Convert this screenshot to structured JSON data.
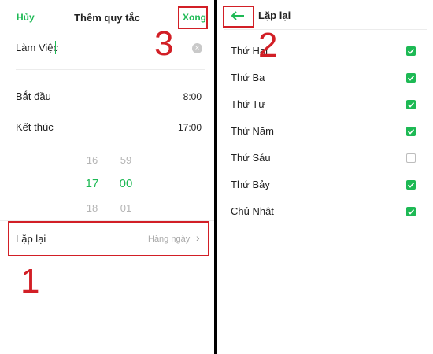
{
  "left": {
    "header": {
      "cancel": "Hủy",
      "title": "Thêm quy tắc",
      "done": "Xong"
    },
    "name_value": "Làm Việc",
    "clear_icon": "×",
    "start": {
      "label": "Bắt đầu",
      "value": "8:00"
    },
    "end": {
      "label": "Kết thúc",
      "value": "17:00"
    },
    "picker": {
      "hours": [
        "16",
        "17",
        "18"
      ],
      "minutes": [
        "59",
        "00",
        "01"
      ]
    },
    "repeat": {
      "label": "Lặp lại",
      "value": "Hàng ngày",
      "chevron": "›"
    },
    "annotations": {
      "one": "1",
      "three": "3"
    }
  },
  "right": {
    "title": "Lặp lại",
    "annotation_two": "2",
    "days": [
      {
        "label": "Thứ Hai",
        "checked": true
      },
      {
        "label": "Thứ Ba",
        "checked": true
      },
      {
        "label": "Thứ Tư",
        "checked": true
      },
      {
        "label": "Thứ Năm",
        "checked": true
      },
      {
        "label": "Thứ Sáu",
        "checked": false
      },
      {
        "label": "Thứ Bảy",
        "checked": true
      },
      {
        "label": "Chủ Nhật",
        "checked": true
      }
    ]
  },
  "colors": {
    "accent": "#1db954",
    "annotation": "#d21f26"
  },
  "icons": {
    "back": "arrow-left-icon",
    "check": "checkmark-icon",
    "clear": "clear-icon",
    "chevron": "chevron-right-icon"
  }
}
